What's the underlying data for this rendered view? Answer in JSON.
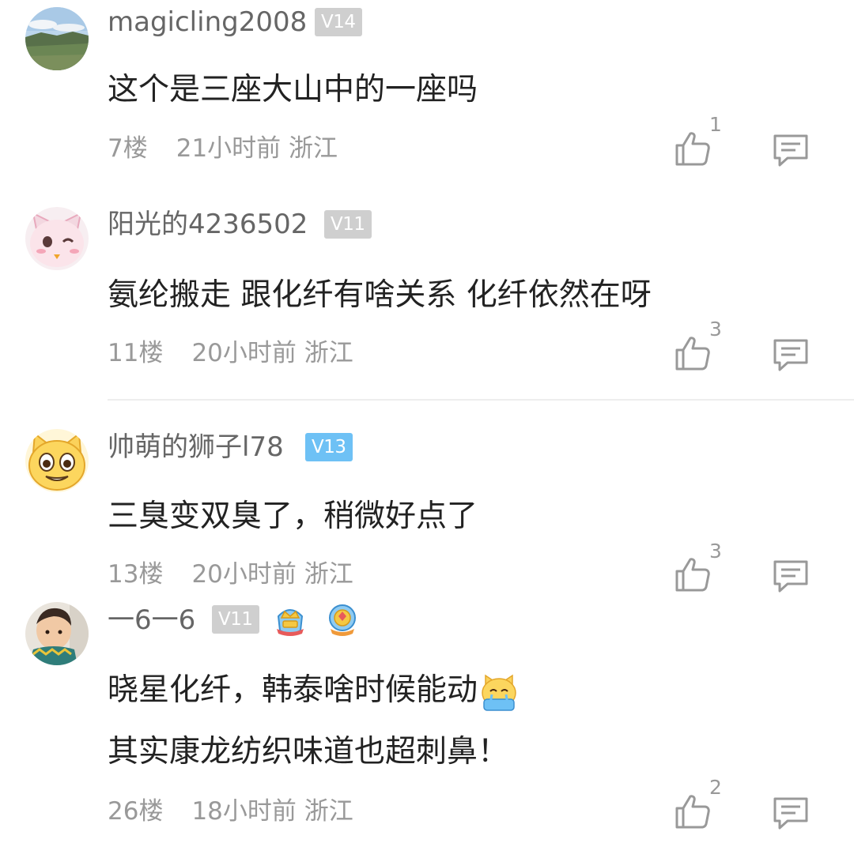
{
  "comments": [
    {
      "username": "magicling2008",
      "level": "V14",
      "text": "这个是三座大山中的一座吗",
      "floor": "7楼",
      "time": "21小时前",
      "location": "浙江",
      "likes": "1",
      "avatar_icon": "landscape-avatar-icon"
    },
    {
      "username": "阳光的4236502",
      "level": "V11",
      "text": "氨纶搬走 跟化纤有啥关系 化纤依然在呀",
      "floor": "11楼",
      "time": "20小时前",
      "location": "浙江",
      "likes": "3",
      "avatar_icon": "pink-cat-avatar-icon"
    },
    {
      "username": "帅萌的狮子l78",
      "level": "V13",
      "text": "三臭变双臭了，稍微好点了",
      "floor": "13楼",
      "time": "20小时前",
      "location": "浙江",
      "likes": "3",
      "avatar_icon": "yellow-cat-avatar-icon"
    },
    {
      "username": "一6一6",
      "level": "V11",
      "text_line1": "晓星化纤，韩泰啥时候能动",
      "text_line2": "其实康龙纺织味道也超刺鼻！",
      "floor": "26楼",
      "time": "18小时前",
      "location": "浙江",
      "likes": "2",
      "avatar_icon": "baby-photo-avatar-icon"
    }
  ],
  "colors": {
    "badge_gray": "#cfcfcf",
    "badge_blue": "#6ec1f5",
    "meta_gray": "#999999",
    "username_gray": "#666666",
    "text_dark": "#222222"
  }
}
